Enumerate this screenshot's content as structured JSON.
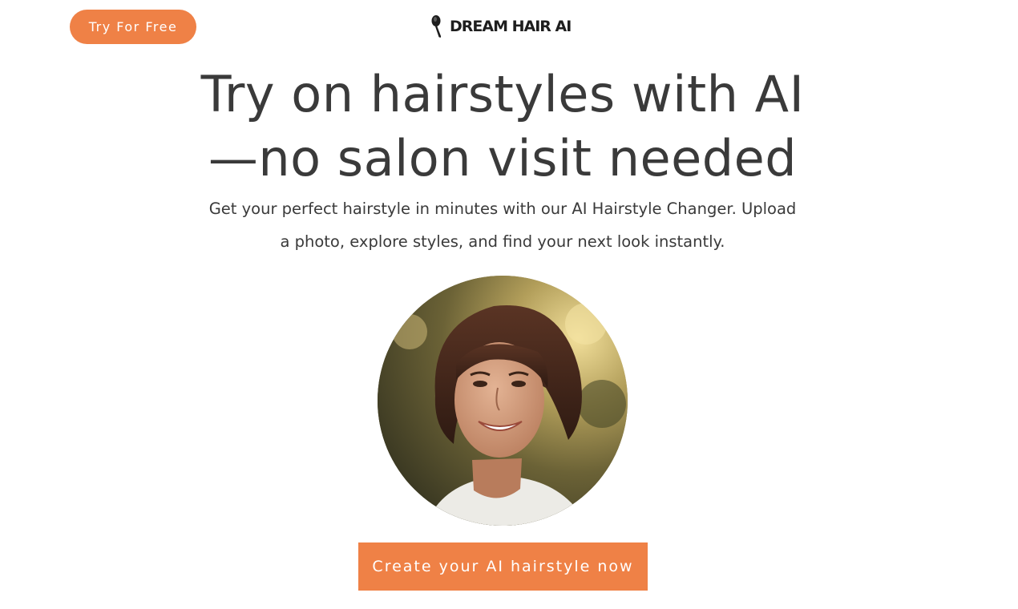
{
  "header": {
    "try_button_label": "Try For Free",
    "logo_text": "DREAM HAIR AI"
  },
  "hero": {
    "headline_line1": "Try on hairstyles with AI",
    "headline_line2": "—no salon visit needed",
    "subtitle_line1": "Get your perfect hairstyle in minutes with our AI Hairstyle Changer. Upload",
    "subtitle_line2": "a photo, explore styles, and find your next look instantly."
  },
  "cta": {
    "label": "Create your AI hairstyle now"
  },
  "colors": {
    "accent": "#ef8146",
    "text": "#3a3a3a",
    "logo": "#1e1e1e"
  },
  "icons": {
    "logo": "hair-dryer-icon"
  }
}
